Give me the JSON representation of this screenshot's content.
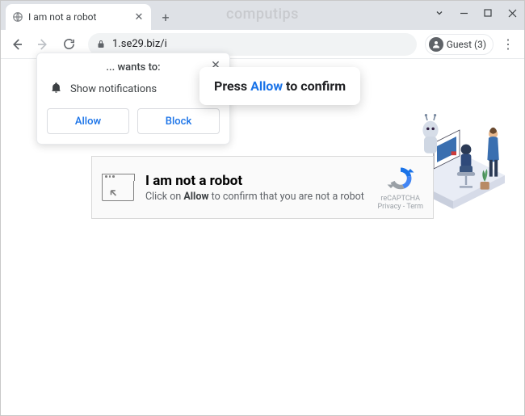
{
  "window": {
    "watermark": "computips"
  },
  "tab": {
    "title": "I am not a robot"
  },
  "toolbar": {
    "url": "1.se29.biz/i",
    "guest_label": "Guest (3)"
  },
  "perm": {
    "wants_to": "... wants to:",
    "show_notifications": "Show notifications",
    "allow": "Allow",
    "block": "Block"
  },
  "overlay": {
    "press": "Press ",
    "allow": "Allow",
    "confirm": " to confirm"
  },
  "captcha": {
    "heading": "I am not a robot",
    "pre": "Click on ",
    "bold": "Allow",
    "post": " to confirm that you are not a robot",
    "brand": "reCAPTCHA",
    "links": "Privacy - Term"
  }
}
